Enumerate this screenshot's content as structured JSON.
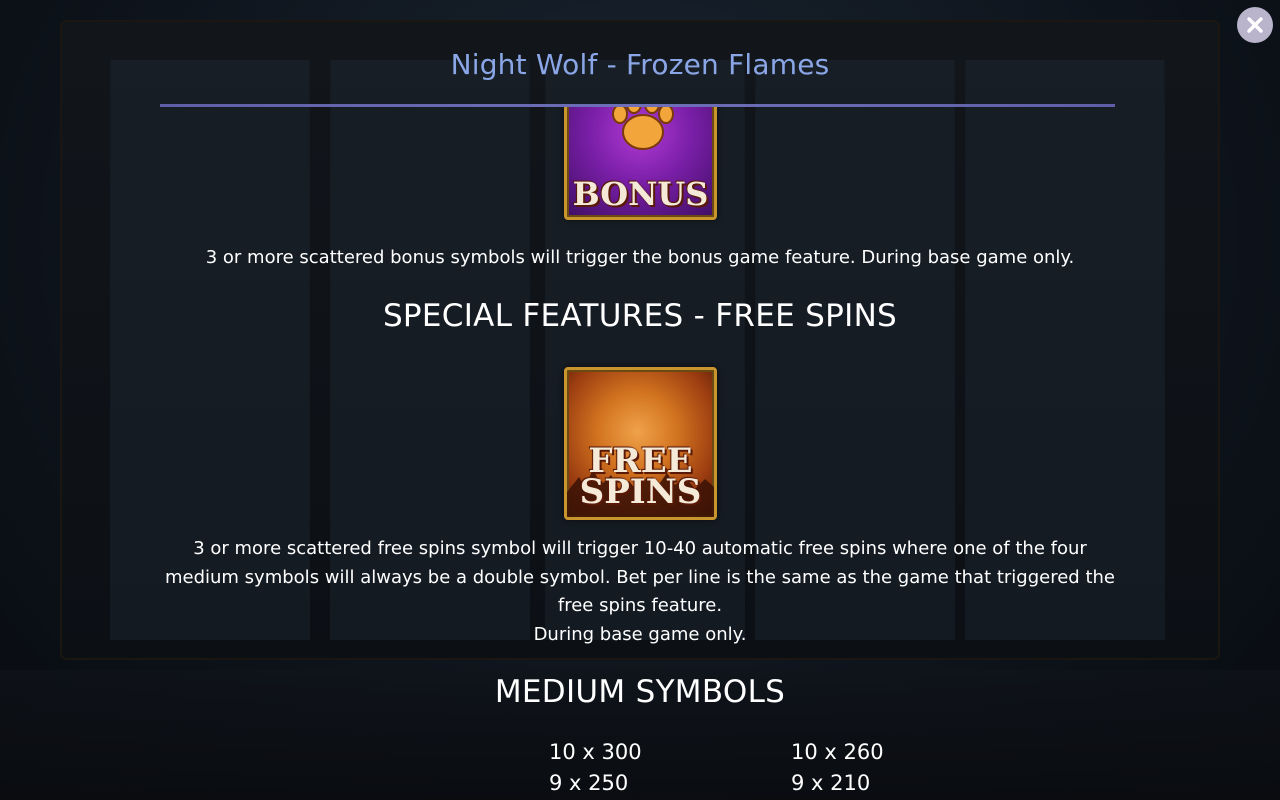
{
  "header": {
    "title": "Night Wolf - Frozen Flames"
  },
  "close_button": {
    "icon": "close-icon",
    "color": "#b9b3cb"
  },
  "bonus": {
    "symbol_label": "BONUS",
    "description": "3 or more scattered bonus symbols will trigger the bonus game feature. During base game only."
  },
  "free_spins": {
    "heading": "SPECIAL FEATURES - FREE SPINS",
    "symbol_label_line1": "FREE",
    "symbol_label_line2": "SPINS",
    "description_line1": "3 or more scattered free spins symbol will trigger 10-40 automatic free spins where one of the four",
    "description_line2": "medium symbols will always be a double symbol. Bet per line is the same as the game that triggered the",
    "description_line3": "free spins feature.",
    "description_line4": "During base game only."
  },
  "medium_symbols": {
    "heading": "MEDIUM SYMBOLS",
    "columns": [
      {
        "rows": [
          "10 x 300",
          "9 x 250"
        ]
      },
      {
        "rows": [
          "10 x 260",
          "9 x 210"
        ]
      }
    ]
  },
  "colors": {
    "title": "#8aa6e6",
    "rule": "#6d6fb8",
    "frame_gold": "#c8962d"
  }
}
